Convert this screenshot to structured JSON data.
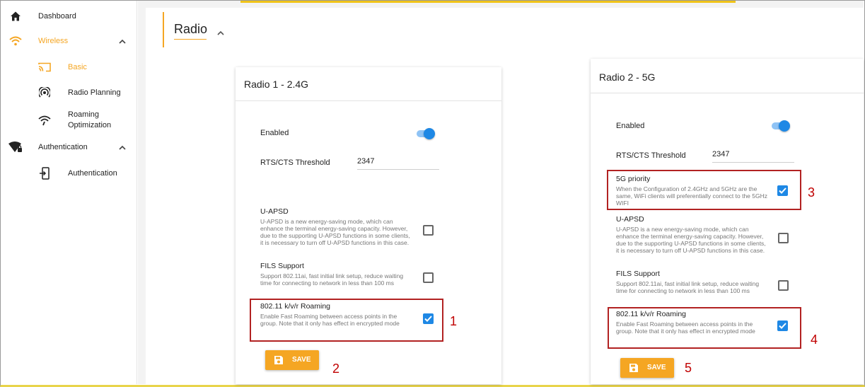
{
  "sidebar": {
    "dashboard": "Dashboard",
    "wireless": "Wireless",
    "basic": "Basic",
    "radio_planning": "Radio Planning",
    "roaming_line1": "Roaming",
    "roaming_line2": "Optimization",
    "authentication_group": "Authentication",
    "authentication_item": "Authentication"
  },
  "section": {
    "title": "Radio"
  },
  "radio1": {
    "title": "Radio 1 - 2.4G",
    "enabled_label": "Enabled",
    "enabled": true,
    "rts_label": "RTS/CTS Threshold",
    "rts_value": "2347",
    "uapsd_title": "U-APSD",
    "uapsd_desc": "U-APSD is a new energy-saving mode, which can enhance the terminal energy-saving capacity. However, due to the supporting U-APSD functions in some clients, it is necessary to turn off U-APSD functions in this case.",
    "uapsd_checked": false,
    "fils_title": "FILS Support",
    "fils_desc": "Support 802.11ai, fast initial link setup, reduce waiting time for connecting to network in less than 100 ms",
    "fils_checked": false,
    "roam_title": "802.11 k/v/r Roaming",
    "roam_desc": "Enable Fast Roaming between access points in the group. Note that it only has effect in encrypted mode",
    "roam_checked": true,
    "save_label": "SAVE"
  },
  "radio2": {
    "title": "Radio 2 - 5G",
    "enabled_label": "Enabled",
    "enabled": true,
    "rts_label": "RTS/CTS Threshold",
    "rts_value": "2347",
    "priority_title": "5G priority",
    "priority_desc": "When the Configuration of 2.4GHz and 5GHz are the same, WiFi clients will preferentially connect to the 5GHz WIFI",
    "priority_checked": true,
    "uapsd_title": "U-APSD",
    "uapsd_desc": "U-APSD is a new energy-saving mode, which can enhance the terminal energy-saving capacity. However, due to the supporting U-APSD functions in some clients, it is necessary to turn off U-APSD functions in this case.",
    "uapsd_checked": false,
    "fils_title": "FILS Support",
    "fils_desc": "Support 802.11ai, fast initial link setup, reduce waiting time for connecting to network in less than 100 ms",
    "fils_checked": false,
    "roam_title": "802.11 k/v/r Roaming",
    "roam_desc": "Enable Fast Roaming between access points in the group. Note that it only has effect in encrypted mode",
    "roam_checked": true,
    "save_label": "SAVE"
  },
  "markers": {
    "m1": "1",
    "m2": "2",
    "m3": "3",
    "m4": "4",
    "m5": "5"
  },
  "colors": {
    "accent": "#f5a623",
    "primary": "#1e88e5",
    "highlight_box": "#b22222",
    "marker": "#c00000"
  }
}
